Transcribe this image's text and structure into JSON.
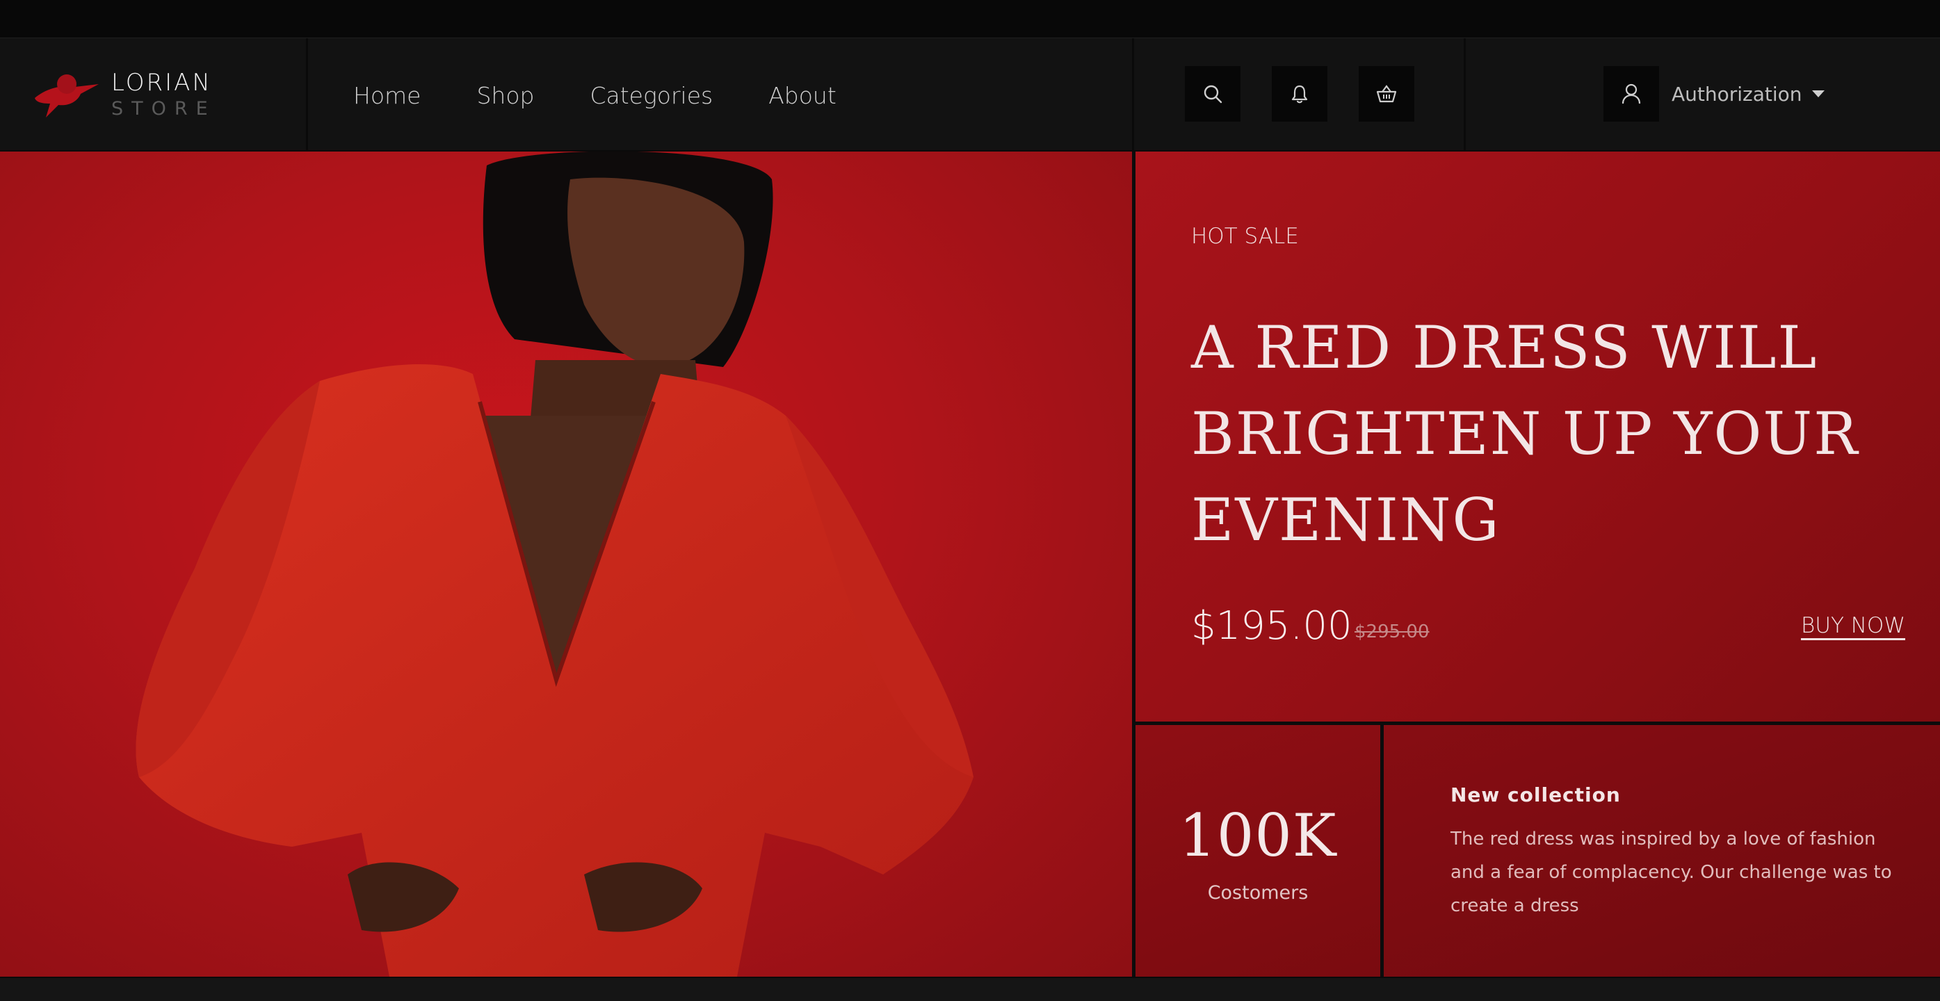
{
  "brand": {
    "name": "LORIAN",
    "sub": "STORE"
  },
  "nav": {
    "items": [
      "Home",
      "Shop",
      "Categories",
      "About"
    ]
  },
  "header": {
    "auth_label": "Authorization"
  },
  "icons": {
    "search": "search-icon",
    "bell": "bell-icon",
    "cart": "basket-icon",
    "user": "user-icon",
    "logo": "hat-logo-icon"
  },
  "promo": {
    "tag": "HOT SALE",
    "headline": "A RED DRESS WILL BRIGHTEN UP YOUR EVENING",
    "price": "$195.00",
    "old_price": "$295.00",
    "cta": "BUY NOW"
  },
  "stat": {
    "value": "100K",
    "caption": "Costomers"
  },
  "collection": {
    "title": "New collection",
    "description": "The red dress was inspired by a love of fashion and a fear of complacency. Our challenge was to create a dress"
  },
  "colors": {
    "accent_red": "#b0141a",
    "dark": "#121212",
    "logo_red": "#b5121b"
  }
}
